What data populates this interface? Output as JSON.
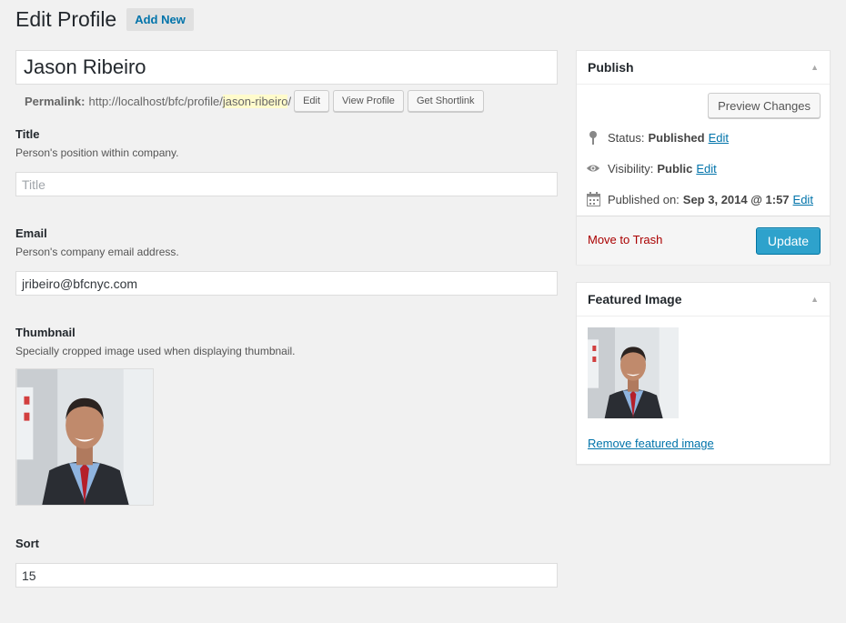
{
  "header": {
    "title": "Edit Profile",
    "add_new": "Add New"
  },
  "post": {
    "title": "Jason Ribeiro",
    "permalink_label": "Permalink:",
    "permalink_base": "http://localhost/bfc/profile/",
    "permalink_slug": "jason-ribeiro",
    "permalink_suffix": "/",
    "edit_label": "Edit",
    "view_label": "View Profile",
    "shortlink_label": "Get Shortlink"
  },
  "fields": {
    "title": {
      "label": "Title",
      "description": "Person's position within company.",
      "placeholder": "Title",
      "value": ""
    },
    "email": {
      "label": "Email",
      "description": "Person's company email address.",
      "value": "jribeiro@bfcnyc.com"
    },
    "thumbnail": {
      "label": "Thumbnail",
      "description": "Specially cropped image used when displaying thumbnail."
    },
    "sort": {
      "label": "Sort",
      "value": "15"
    }
  },
  "publish": {
    "title": "Publish",
    "preview_label": "Preview Changes",
    "status_label": "Status:",
    "status_value": "Published",
    "visibility_label": "Visibility:",
    "visibility_value": "Public",
    "published_label": "Published on:",
    "published_value": "Sep 3, 2014 @ 1:57",
    "edit_link": "Edit",
    "trash_label": "Move to Trash",
    "update_label": "Update"
  },
  "featured": {
    "title": "Featured Image",
    "remove_label": "Remove featured image"
  },
  "icons": {
    "toggle": "triangle-up-icon",
    "status": "pin-icon",
    "visibility": "eye-icon",
    "calendar": "calendar-icon"
  },
  "colors": {
    "link": "#0073aa",
    "update_button": "#2ea2cc",
    "trash": "#a00000",
    "slug_highlight": "#fffbcc"
  }
}
